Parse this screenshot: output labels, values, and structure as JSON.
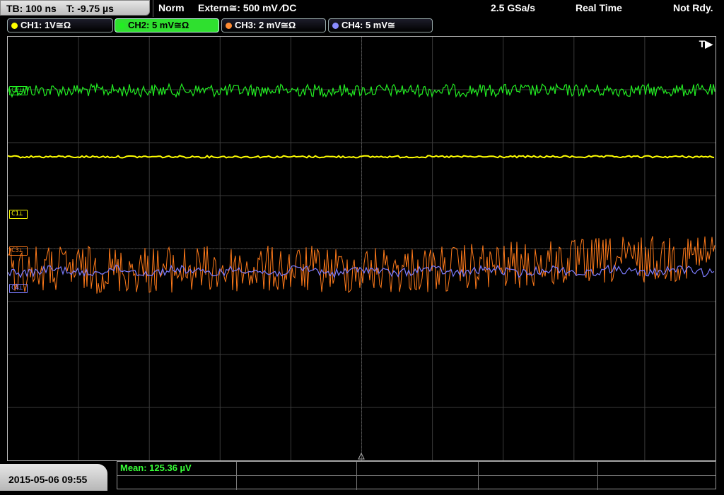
{
  "topbar": {
    "timebase": "TB: 100 ns",
    "trigger_time": "T: -9.75 µs",
    "mode": "Norm",
    "trigger_source": "Extern≅: 500 mV ⁄DC",
    "sample_rate": "2.5 GSa/s",
    "acq_mode": "Real Time",
    "status": "Not Rdy."
  },
  "channels": [
    {
      "label": "CH1: 1V≅Ω",
      "color": "#ffff00",
      "active": false
    },
    {
      "label": "CH2: 5 mV≅Ω",
      "color": "#22ee22",
      "active": true
    },
    {
      "label": "CH3: 2 mV≅Ω",
      "color": "#ff8c33",
      "active": false
    },
    {
      "label": "CH4: 5 mV≅",
      "color": "#8a8cff",
      "active": false
    }
  ],
  "screen": {
    "trigger_marker": "T▶",
    "channel_markers": [
      "C2⊥",
      "C1⊥",
      "C3⊥",
      "C4⊥"
    ]
  },
  "footer": {
    "datetime": "2015-05-06 09:55",
    "measurement": "Mean: 125.36 µV"
  },
  "colors": {
    "ch1": "#ffff00",
    "ch2": "#22ee22",
    "ch3": "#ff7a1a",
    "ch4": "#7c7cff",
    "grid": "#3a3a3a"
  }
}
